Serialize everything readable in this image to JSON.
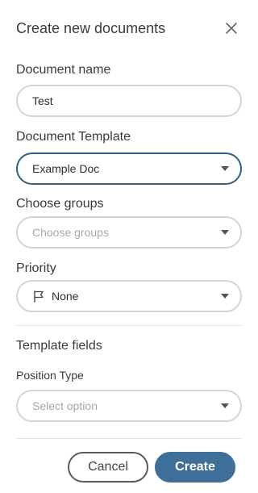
{
  "dialog": {
    "title": "Create new documents",
    "close_icon": "close-icon"
  },
  "document_name": {
    "label": "Document name",
    "value": "Test"
  },
  "document_template": {
    "label": "Document Template",
    "value": "Example Doc"
  },
  "groups": {
    "label": "Choose groups",
    "placeholder": "Choose groups"
  },
  "priority": {
    "label": "Priority",
    "value": "None",
    "icon": "flag-icon"
  },
  "template_fields": {
    "heading": "Template fields",
    "position_type": {
      "label": "Position Type",
      "placeholder": "Select option"
    }
  },
  "actions": {
    "cancel_label": "Cancel",
    "create_label": "Create"
  },
  "colors": {
    "accent": "#3e6f98",
    "focus_border": "#2f5f86"
  }
}
